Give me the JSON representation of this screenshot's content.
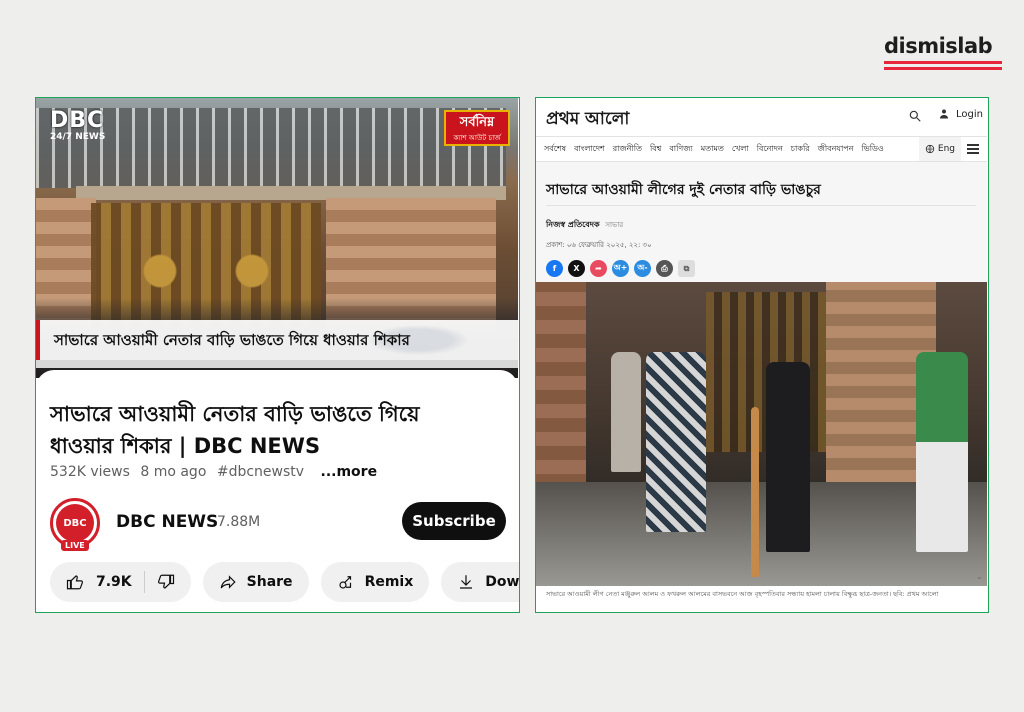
{
  "brand": {
    "name": "dismislab"
  },
  "youtube": {
    "overlay_logo": "DBC",
    "overlay_logo_sub": "24/7 NEWS",
    "overlay_badge": "সর্বনিম্ন",
    "overlay_badge_sub": "ক্যাশ আউট চার্জ",
    "ticker_text": "সাভারে আওয়ামী নেতার বাড়ি ভাঙতে গিয়ে ধাওয়ার শিকার",
    "title": "সাভারে আওয়ামী নেতার বাড়ি ভাঙতে গিয়ে ধাওয়ার শিকার | DBC NEWS",
    "views": "532K views",
    "age": "8 mo ago",
    "hashtag": "#dbcnewstv",
    "more": "...more",
    "channel_name": "DBC NEWS",
    "subscribers": "7.88M",
    "avatar_text": "DBC",
    "avatar_live": "LIVE",
    "subscribe_label": "Subscribe",
    "likes": "7.9K",
    "share_label": "Share",
    "remix_label": "Remix",
    "download_label": "Download"
  },
  "prothomalo": {
    "logo": "প্রথম আলো",
    "login_label": "Login",
    "nav": [
      "সর্বশেষ",
      "বাংলাদেশ",
      "রাজনীতি",
      "বিশ্ব",
      "বাণিজ্য",
      "মতামত",
      "খেলা",
      "বিনোদন",
      "চাকরি",
      "জীবনযাপন",
      "ভিডিও"
    ],
    "lang_label": "Eng",
    "headline": "সাভারে আওয়ামী লীগের দুই নেতার বাড়ি ভাঙচুর",
    "author": "নিজস্ব প্রতিবেদক",
    "place": "সাভার",
    "date": "প্রকাশ: ০৬ ফেব্রুয়ারি ২০২৫, ২২: ৩০",
    "caption": "সাভারে আওয়ামী লীগ নেতা মঞ্জুরুল আলম ও ফখরুল আলমের বাসভবনে আজ বৃহস্পতিবার সন্ধ্যায় হামলা চালায় বিক্ষুব্ধ ছাত্র-জনতা। ছবি: প্রথম আলো"
  },
  "colors": {
    "accent": "#e8263b",
    "panel_border": "#1ea35a",
    "yt_red": "#d21f2a"
  }
}
